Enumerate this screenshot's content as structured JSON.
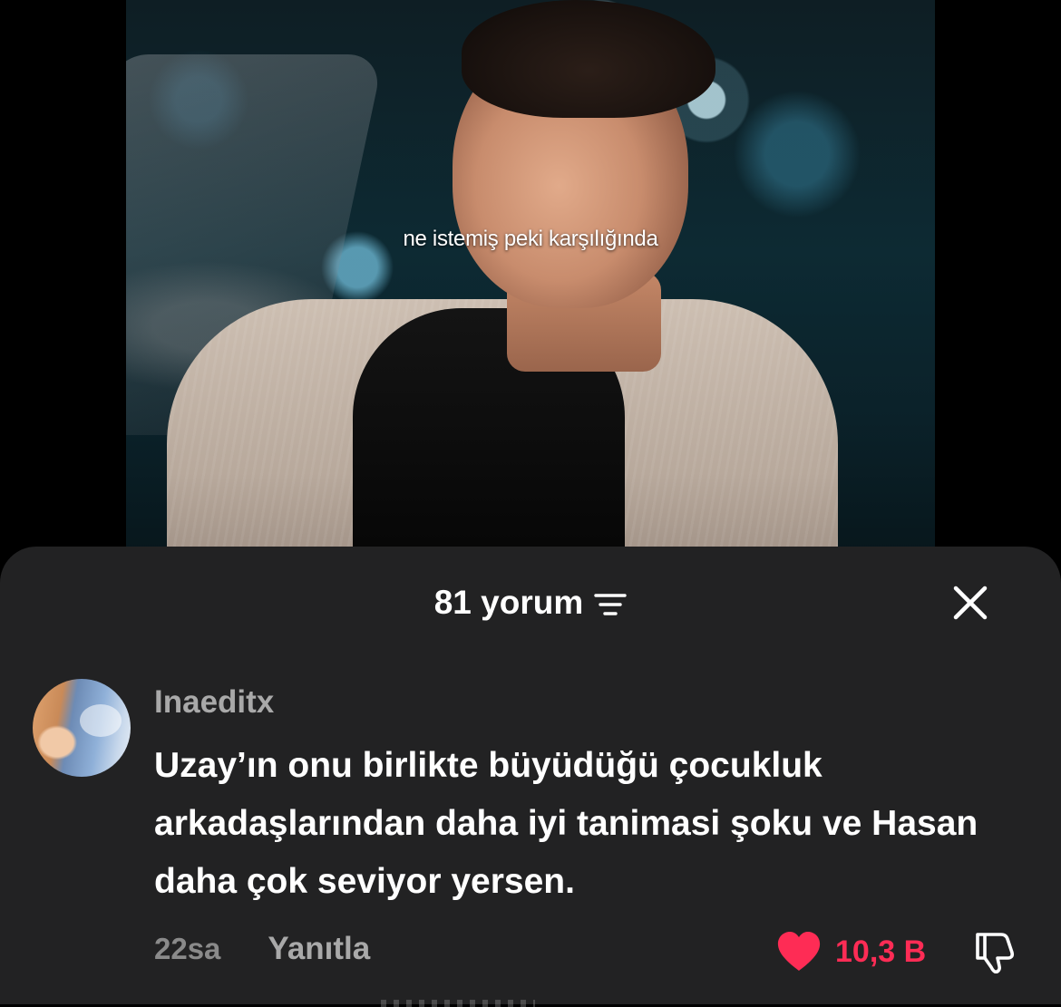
{
  "video": {
    "subtitle": "ne istemiş peki karşılığında"
  },
  "comments_sheet": {
    "title": "81 yorum",
    "filter_icon": "filter-lines-icon",
    "close_icon": "close-x-icon"
  },
  "comment": {
    "username": "Inaeditx",
    "text": "Uzay’ın onu birlikte büyüdüğü çocukluk arkadaşlarından daha iyi tanimasi şoku ve Hasan daha çok seviyor yersen.",
    "time": "22sa",
    "reply_label": "Yanıtla",
    "like_count": "10,3 B",
    "liked": true,
    "like_color": "#fe2c55",
    "dislike_icon": "thumbs-down-icon"
  }
}
